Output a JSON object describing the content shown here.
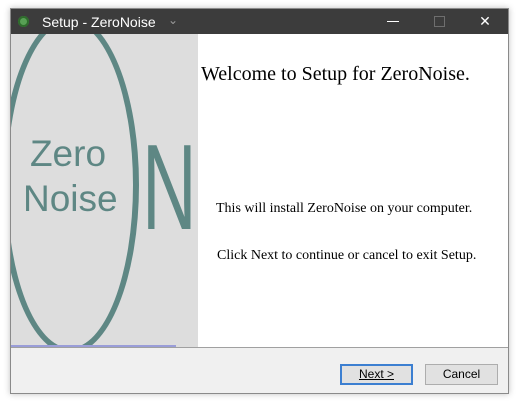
{
  "window": {
    "title": "Setup - ZeroNoise",
    "title_icon": "app-icon",
    "controls": {
      "minimize": "minimize-icon",
      "maximize": "maximize-icon",
      "close": "✕"
    }
  },
  "logo": {
    "line1": "Zero",
    "line2": "Noise",
    "big_letter": "N",
    "color": "#5e8784"
  },
  "welcome": {
    "heading": "Welcome to Setup for ZeroNoise.",
    "install_text": "This will install ZeroNoise on your computer.",
    "continue_text": "Click Next to continue or cancel to exit Setup."
  },
  "buttons": {
    "next": "Next >",
    "cancel": "Cancel"
  },
  "colors": {
    "titlebar": "#3c3c3c",
    "accent": "#3c7fd1"
  }
}
